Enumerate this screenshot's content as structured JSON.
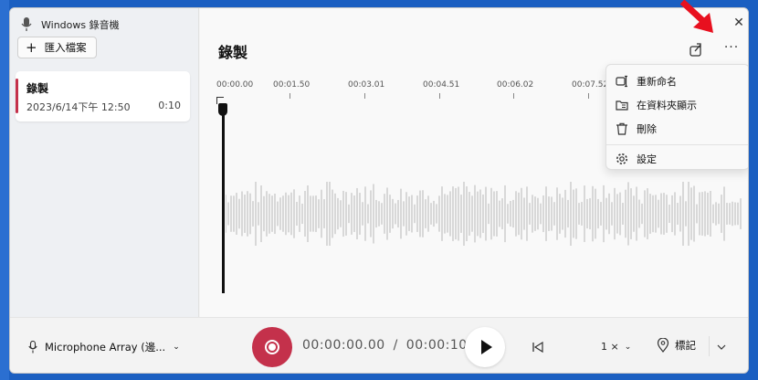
{
  "app": {
    "title": "Windows 錄音機"
  },
  "sidebar": {
    "import_label": "匯入檔案",
    "recordings": [
      {
        "title": "錄製",
        "date": "2023/6/14下午 12:50",
        "duration": "0:10"
      }
    ]
  },
  "main": {
    "title": "錄製",
    "timeline": {
      "ticks": [
        "00:00.00",
        "00:01.50",
        "00:03.01",
        "00:04.51",
        "00:06.02",
        "00:07.52"
      ]
    }
  },
  "menu": {
    "items": [
      {
        "label": "重新命名",
        "icon": "rename-icon"
      },
      {
        "label": "在資料夾顯示",
        "icon": "folder-icon"
      },
      {
        "label": "刪除",
        "icon": "trash-icon"
      },
      {
        "label": "設定",
        "icon": "gear-icon"
      }
    ]
  },
  "bottom": {
    "microphone": "Microphone Array (邊...",
    "elapsed": "00:00:00.00",
    "separator": "/",
    "total": "00:00:10",
    "speed": "1 ×",
    "marker_label": "標記"
  },
  "colors": {
    "accent": "#c4314b",
    "annotation_arrow": "#e8101f"
  }
}
